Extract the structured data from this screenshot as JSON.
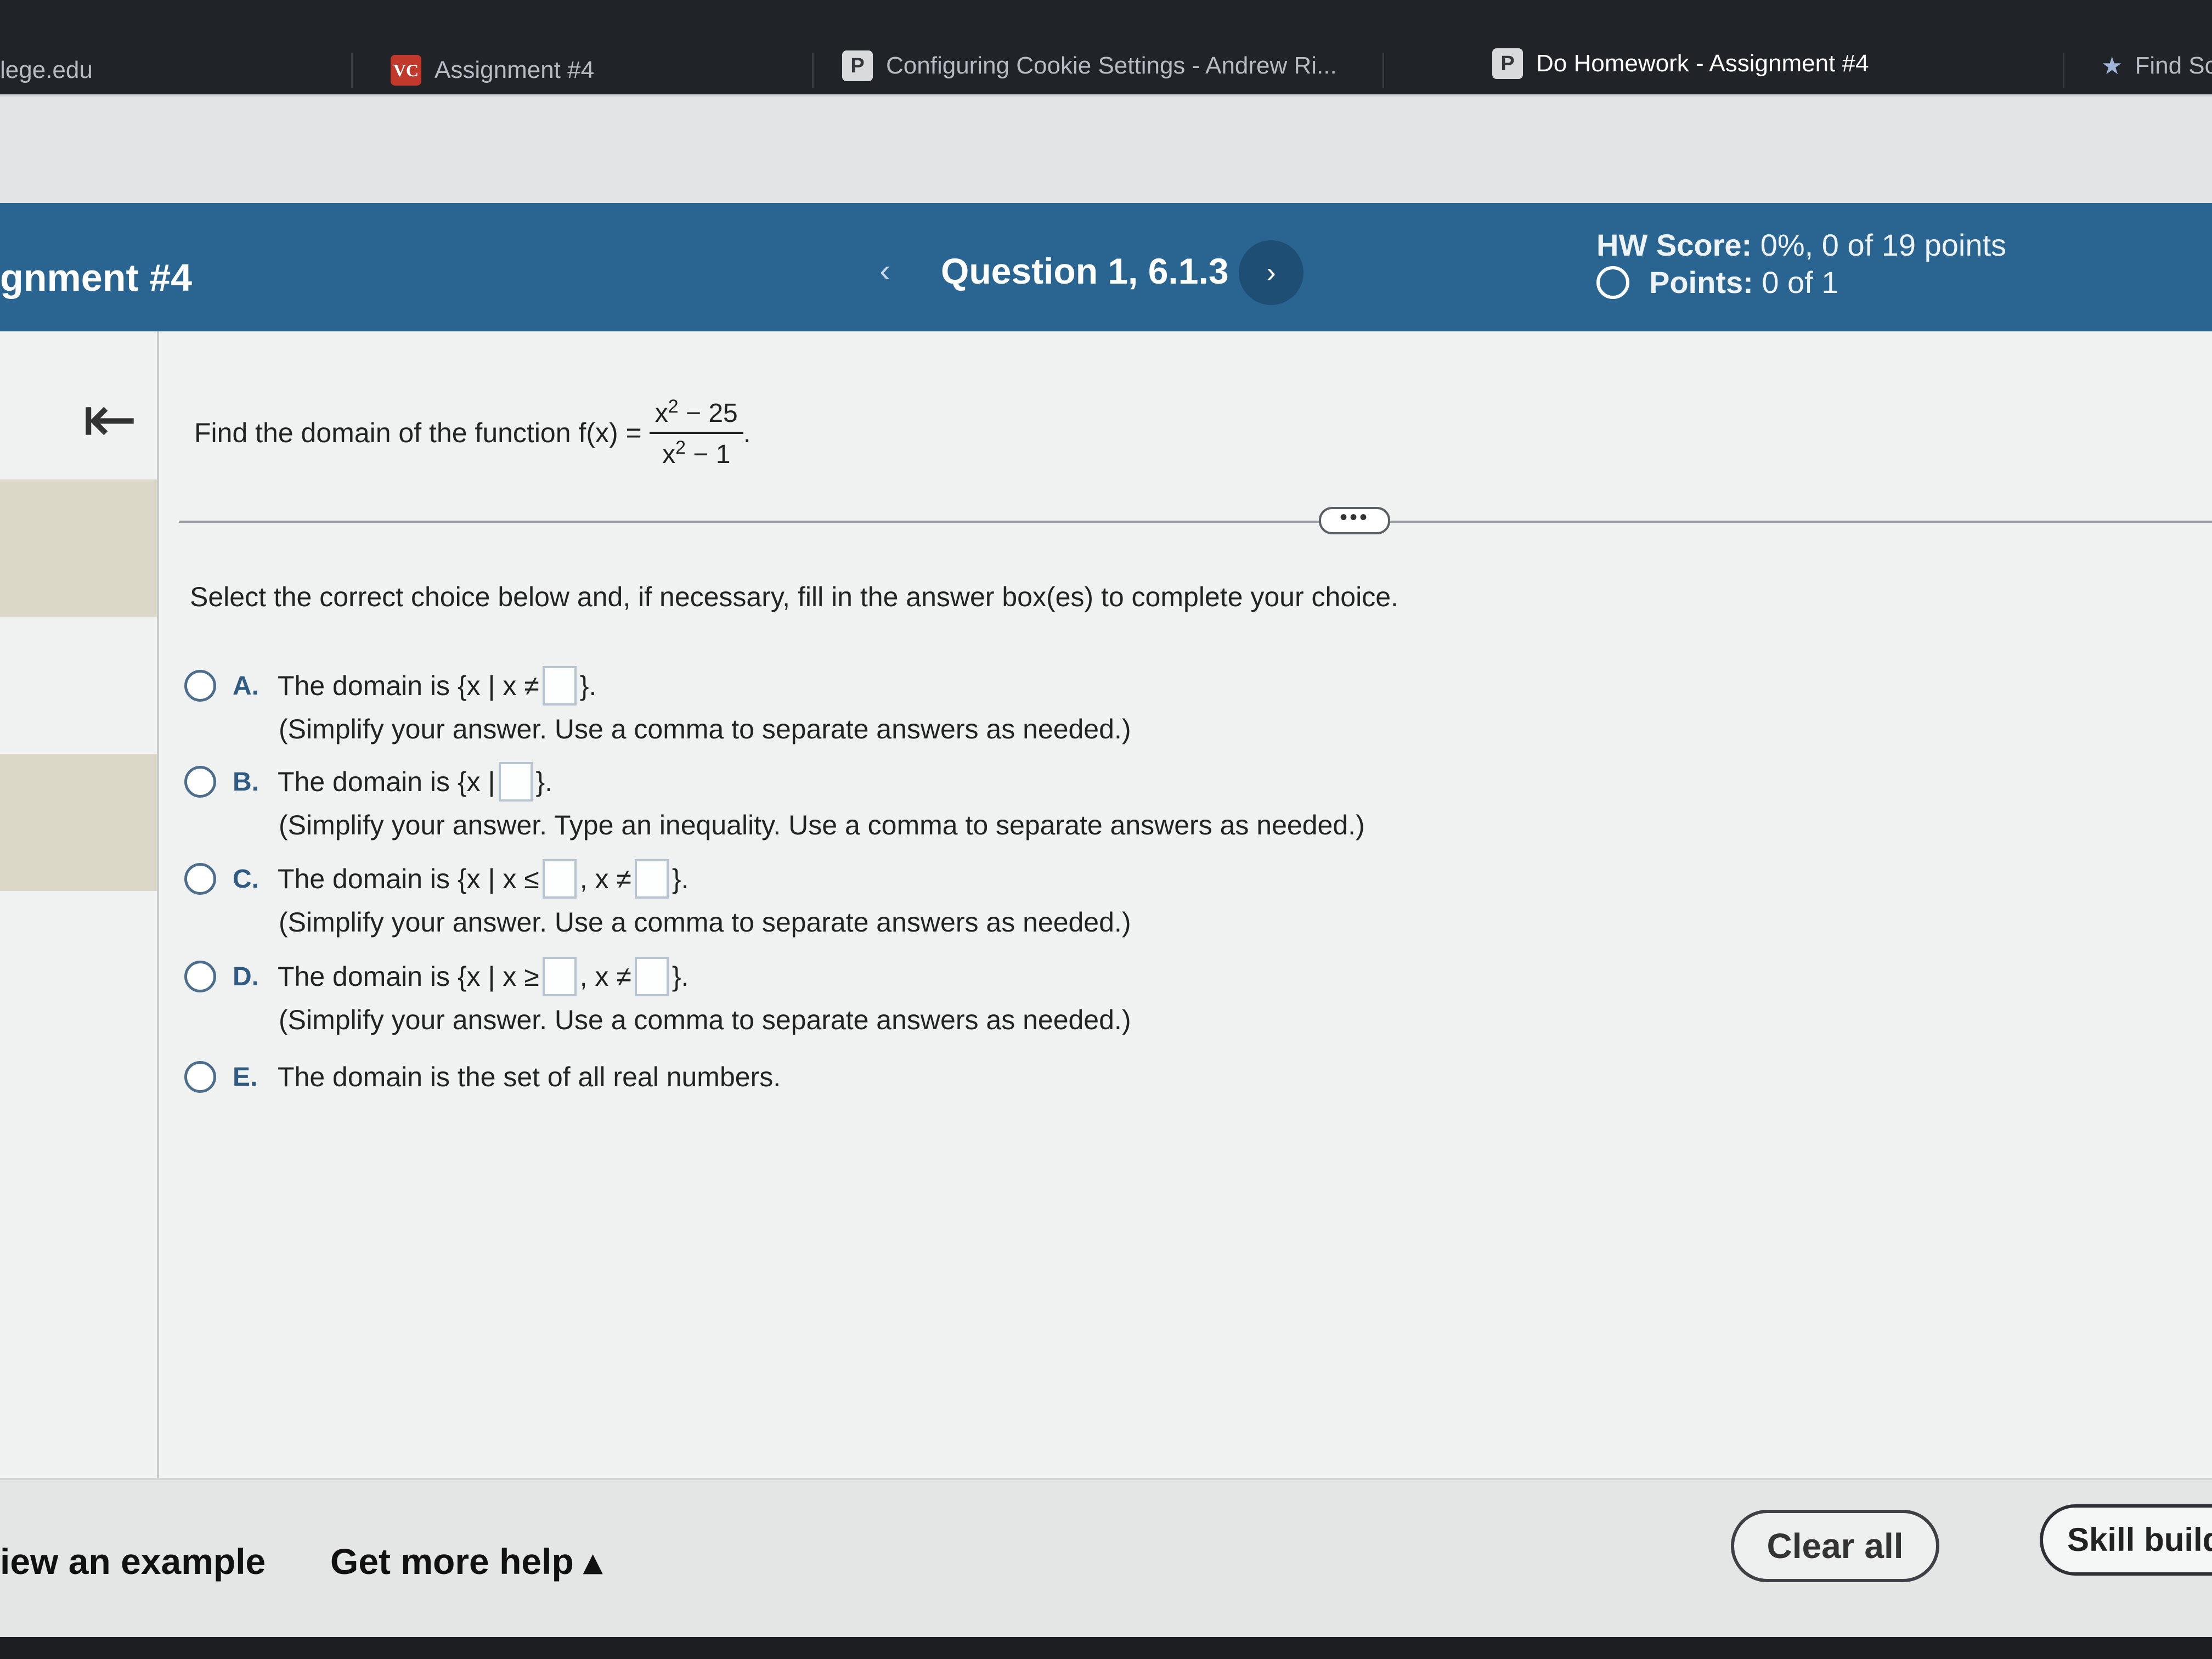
{
  "browser": {
    "tabs": [
      {
        "label": "lege.edu",
        "favicon": ""
      },
      {
        "label": "Assignment #4",
        "favicon": "VC"
      },
      {
        "label": "Configuring Cookie Settings - Andrew Ri...",
        "favicon": "P"
      },
      {
        "label": "Do Homework - Assignment #4",
        "favicon": "P"
      },
      {
        "label": "Find Sc",
        "favicon": "star-icon"
      }
    ]
  },
  "header": {
    "assignment_title": "gnment #4",
    "prev_glyph": "‹",
    "question_title": "Question 1, 6.1.3",
    "next_glyph": "›",
    "hw_score_label": "HW Score:",
    "hw_score_value": "0%, 0 of 19 points",
    "points_label": "Points:",
    "points_value": "0 of 1"
  },
  "question": {
    "collapse_glyph": "⇤",
    "prompt": "Find the domain of the function f(x) =",
    "numerator_base": "x",
    "numerator_exp": "2",
    "numerator_rest": " − 25",
    "denominator_base": "x",
    "denominator_exp": "2",
    "denominator_rest": " − 1",
    "trailing": "."
  },
  "more_button": "•••",
  "instruction": "Select the correct choice below and, if necessary, fill in the answer box(es) to complete your choice.",
  "choices": [
    {
      "letter": "A.",
      "text_before": "The domain is",
      "set_open": "{x | x ≠",
      "set_close": "}.",
      "hint": "(Simplify your answer. Use a comma to separate answers as needed.)"
    },
    {
      "letter": "B.",
      "text_before": "The domain is",
      "set_open": "{x |",
      "set_close": "}.",
      "hint": "(Simplify your answer. Type an inequality. Use a comma to separate answers as needed.)"
    },
    {
      "letter": "C.",
      "text_before": "The domain is",
      "set_open": "{x | x ≤",
      "mid": ", x ≠",
      "set_close": "}.",
      "hint": "(Simplify your answer. Use a comma to separate answers as needed.)"
    },
    {
      "letter": "D.",
      "text_before": "The domain is",
      "set_open": "{x | x ≥",
      "mid": ", x ≠",
      "set_close": "}.",
      "hint": "(Simplify your answer. Use a comma to separate answers as needed.)"
    },
    {
      "letter": "E.",
      "text_before": "The domain is the set of all real numbers."
    }
  ],
  "footer": {
    "view_example": "iew an example",
    "get_more_help": "Get more help ▴",
    "clear_all": "Clear all",
    "skill_builder": "Skill build"
  },
  "colors": {
    "header_blue": "#2a6592",
    "accent_blue": "#2f5a82",
    "tabbar": "#202327"
  }
}
